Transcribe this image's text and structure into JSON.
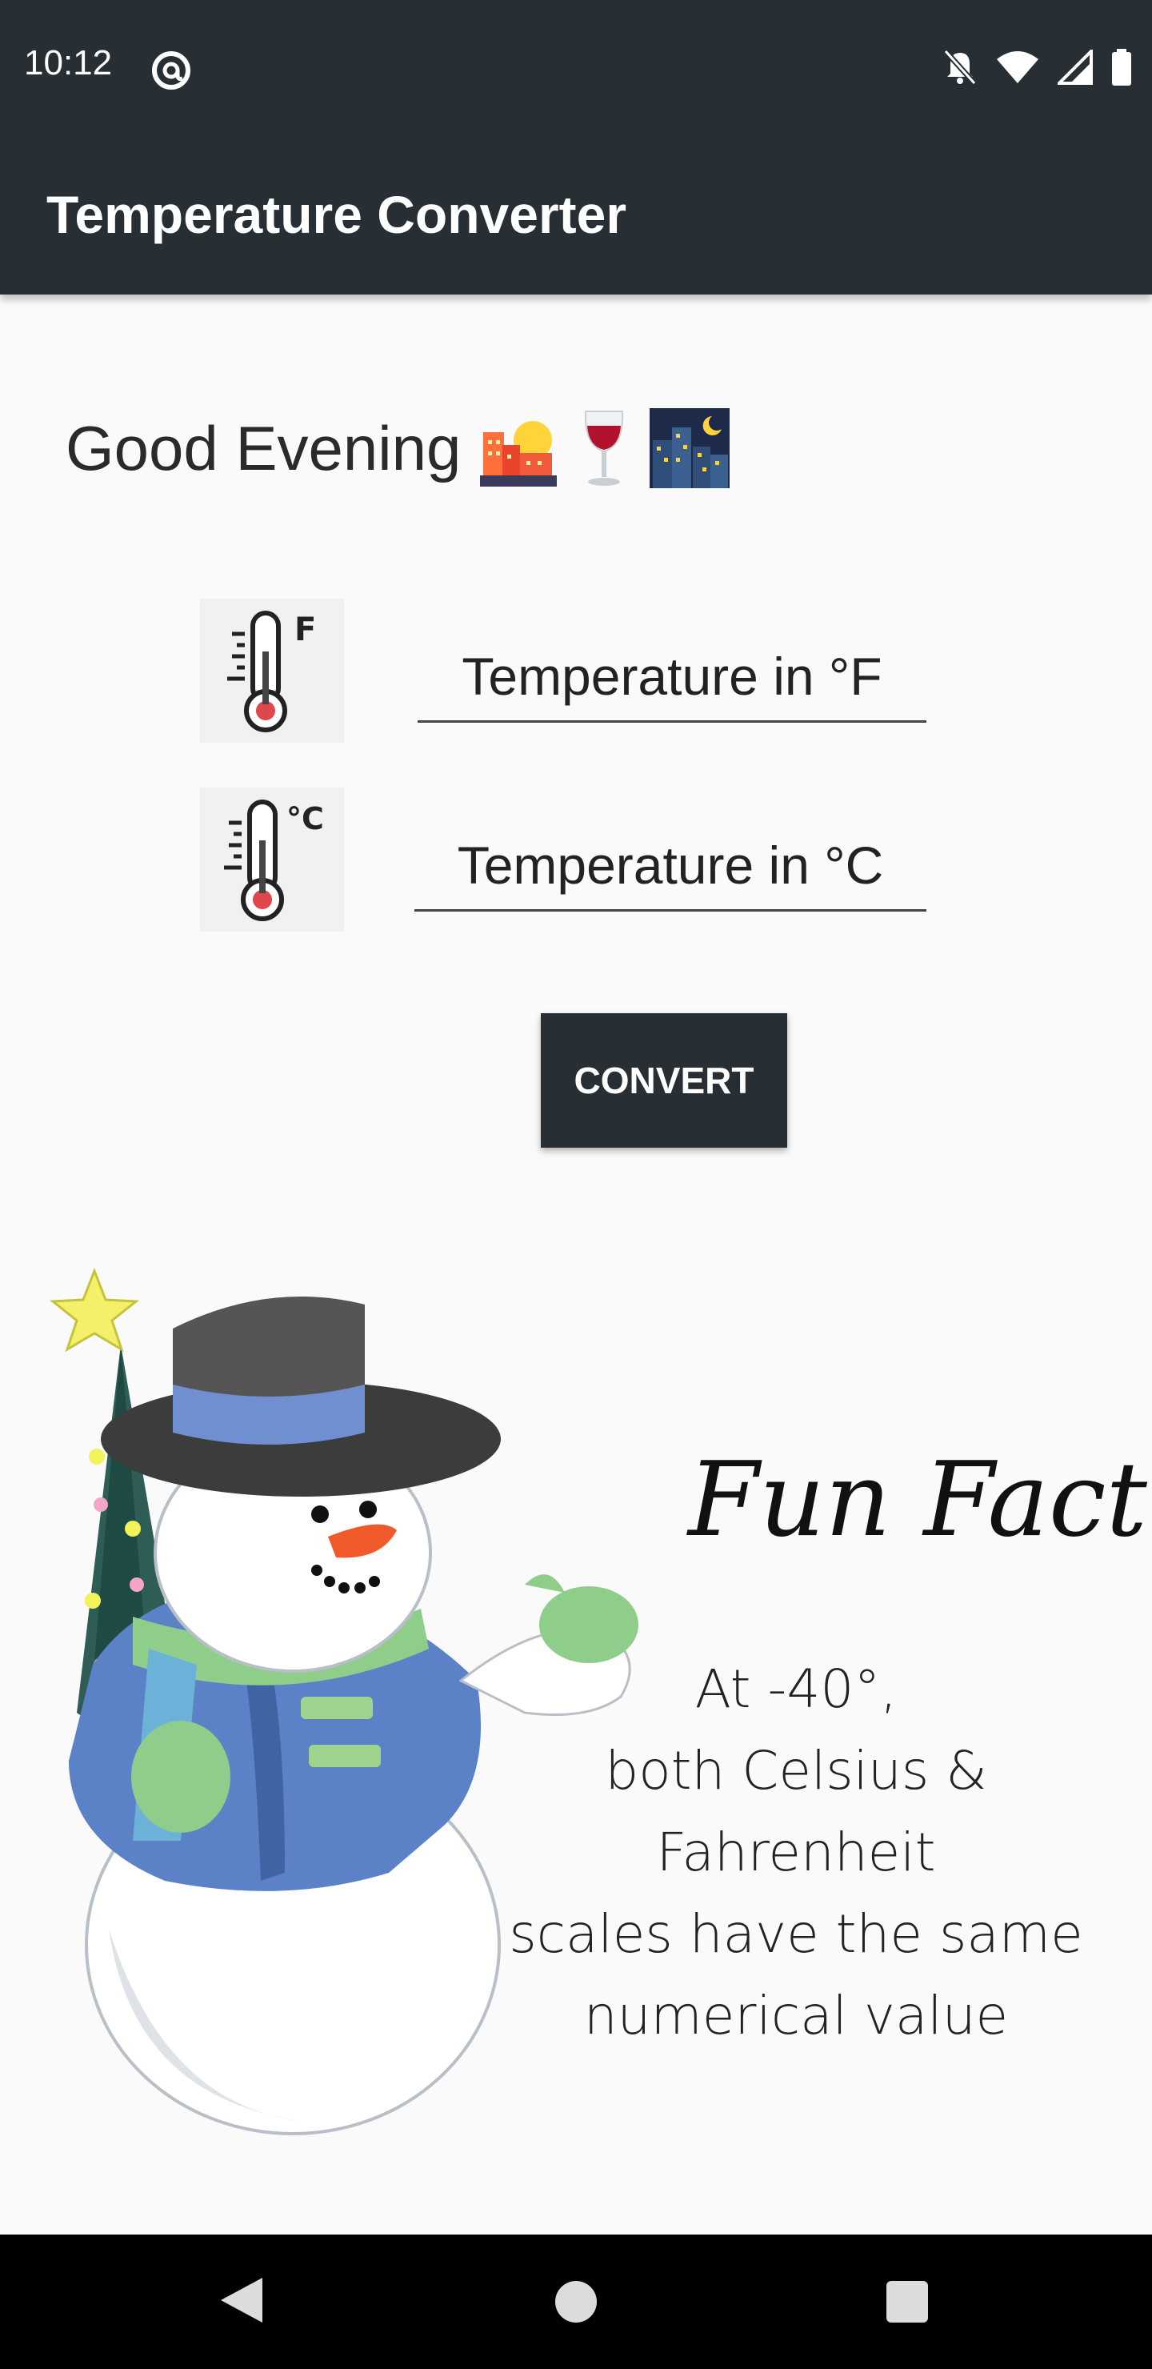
{
  "status_bar": {
    "time": "10:12",
    "icons": [
      "at-sign-icon",
      "notifications-off-icon",
      "wifi-icon",
      "signal-icon",
      "battery-icon"
    ]
  },
  "app_bar": {
    "title": "Temperature Converter"
  },
  "greeting": {
    "text": "Good Evening",
    "emojis": [
      "city-sunset-emoji",
      "wine-glass-emoji",
      "night-city-emoji"
    ]
  },
  "fields": {
    "fahrenheit": {
      "placeholder": "Temperature in °F",
      "value": "",
      "icon": "thermometer-f-icon",
      "icon_unit": "F"
    },
    "celsius": {
      "placeholder": "Temperature in °C",
      "value": "",
      "icon": "thermometer-c-icon",
      "icon_unit": "°C"
    }
  },
  "convert_button": {
    "label": "CONVERT"
  },
  "fun_fact": {
    "title": "Fun Fact",
    "lines": [
      "At -40°,",
      "both Celsius & Fahrenheit",
      "scales have the same",
      "numerical value"
    ]
  },
  "colors": {
    "primary_dark": "#272f35",
    "background": "#fafafa"
  }
}
